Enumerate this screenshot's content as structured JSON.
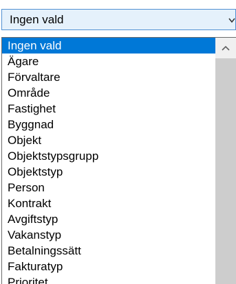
{
  "combo": {
    "selected_value": "Ingen vald",
    "chevron_icon": "chevron-down-icon"
  },
  "dropdown": {
    "items": [
      {
        "label": "Ingen vald",
        "selected": true
      },
      {
        "label": "Ägare",
        "selected": false
      },
      {
        "label": "Förvaltare",
        "selected": false
      },
      {
        "label": "Område",
        "selected": false
      },
      {
        "label": "Fastighet",
        "selected": false
      },
      {
        "label": "Byggnad",
        "selected": false
      },
      {
        "label": "Objekt",
        "selected": false
      },
      {
        "label": "Objektstypsgrupp",
        "selected": false
      },
      {
        "label": "Objektstyp",
        "selected": false
      },
      {
        "label": "Person",
        "selected": false
      },
      {
        "label": "Kontrakt",
        "selected": false
      },
      {
        "label": "Avgiftstyp",
        "selected": false
      },
      {
        "label": "Vakanstyp",
        "selected": false
      },
      {
        "label": "Betalningssätt",
        "selected": false
      },
      {
        "label": "Fakturatyp",
        "selected": false
      },
      {
        "label": "Prioritet",
        "selected": false
      }
    ],
    "scroll_up_icon": "chevron-up-icon"
  },
  "colors": {
    "selection": "#0078d7",
    "combo_border": "#4f8fd2",
    "combo_background": "#e5f1fb",
    "scroll_track": "#f0f0f0",
    "scroll_thumb": "#cdcdcd"
  }
}
